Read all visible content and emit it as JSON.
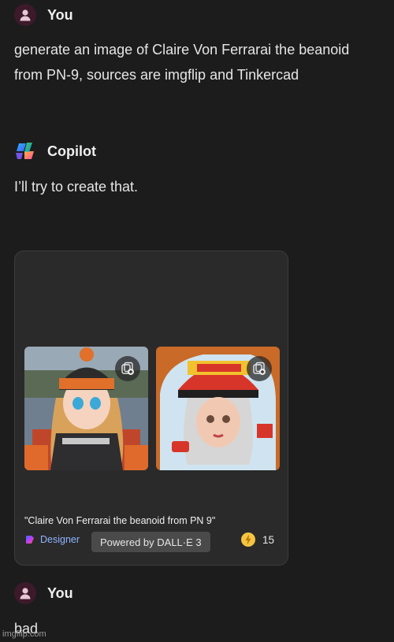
{
  "messages": [
    {
      "sender": "You",
      "text": "generate an image of Claire Von Ferrarai the beanoid from PN-9, sources are imgflip and Tinkercad"
    },
    {
      "sender": "Copilot",
      "text": "I’ll try to create that."
    },
    {
      "sender": "You",
      "text": "bad"
    }
  ],
  "image_card": {
    "caption": "\"Claire Von Ferrarai the beanoid from PN 9\"",
    "designer_label": "Designer",
    "powered_label": "Powered by DALL·E 3",
    "boost_count": "15",
    "images": [
      {
        "icon": "collection-add-icon"
      },
      {
        "icon": "collection-add-icon"
      }
    ]
  },
  "watermark": "imgflip.com",
  "colors": {
    "background": "#1c1c1c",
    "card": "#2a2a2a",
    "designer_link": "#8fb4ff",
    "avatar": "#3d1a2a"
  }
}
